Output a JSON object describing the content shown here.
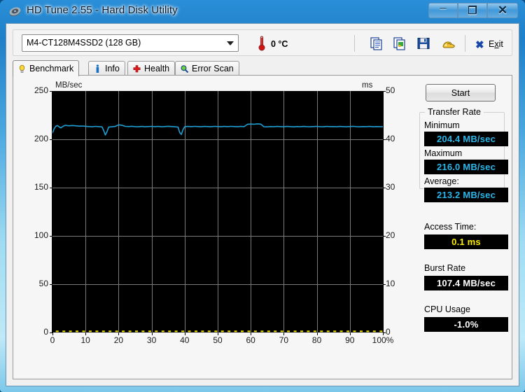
{
  "window": {
    "title": "HD Tune 2.55 - Hard Disk Utility",
    "icon": "hdd-icon",
    "minimize_label": "─",
    "maximize_label": "❐",
    "close_label": "✕"
  },
  "toolbar": {
    "drive": {
      "selected": "M4-CT128M4SSD2 (128 GB)",
      "options": [
        "M4-CT128M4SSD2 (128 GB)"
      ]
    },
    "temperature": "0 °C",
    "temp_icon": "thermometer-icon",
    "buttons": [
      {
        "name": "copy-text-icon",
        "label": ""
      },
      {
        "name": "copy-image-icon",
        "label": ""
      },
      {
        "name": "save-icon",
        "label": ""
      },
      {
        "name": "options-icon",
        "label": ""
      }
    ],
    "exit": {
      "label": "Exit",
      "accel": "x",
      "icon": "close-x-icon"
    }
  },
  "tabs": [
    {
      "label": "Benchmark",
      "icon": "lightbulb-icon",
      "active": true
    },
    {
      "label": "Info",
      "icon": "info-icon",
      "active": false
    },
    {
      "label": "Health",
      "icon": "health-cross-icon",
      "active": false
    },
    {
      "label": "Error Scan",
      "icon": "magnifier-icon",
      "active": false
    }
  ],
  "actions": {
    "start": "Start"
  },
  "results": {
    "transfer_rate": {
      "group_title": "Transfer Rate",
      "minimum_label": "Minimum",
      "minimum_value": "204.4 MB/sec",
      "maximum_label": "Maximum",
      "maximum_value": "216.0 MB/sec",
      "average_label": "Average:",
      "average_value": "213.2 MB/sec"
    },
    "access_time_label": "Access Time:",
    "access_time_value": "0.1 ms",
    "burst_rate_label": "Burst Rate",
    "burst_rate_value": "107.4 MB/sec",
    "cpu_usage_label": "CPU Usage",
    "cpu_usage_value": "-1.0%"
  },
  "colors": {
    "transfer_curve": "#1f9fd4",
    "access_dots": "#f2e300",
    "plot_background": "#000000",
    "grid": "#7a7a7a",
    "value_cyan": "#29b6e8",
    "value_yellow": "#ffee00",
    "value_white": "#ffffff"
  },
  "chart_data": {
    "type": "line",
    "title": "",
    "xlabel": "",
    "ylabel": "MB/sec",
    "y2label": "ms",
    "xlim": [
      0,
      100
    ],
    "ylim": [
      0,
      250
    ],
    "y2lim": [
      0,
      50
    ],
    "grid": true,
    "legend": "none",
    "xticks": [
      0,
      10,
      20,
      30,
      40,
      50,
      60,
      70,
      80,
      90,
      100
    ],
    "xticklabels": [
      "0",
      "10",
      "20",
      "30",
      "40",
      "50",
      "60",
      "70",
      "80",
      "90",
      "100%"
    ],
    "yticks": [
      0,
      50,
      100,
      150,
      200,
      250
    ],
    "yticklabels": [
      "0",
      "50",
      "100",
      "150",
      "200",
      "250"
    ],
    "y2ticks": [
      0,
      10,
      20,
      30,
      40,
      50
    ],
    "y2ticklabels": [
      "0",
      "10",
      "20",
      "30",
      "40",
      "50"
    ],
    "series": [
      {
        "name": "Transfer rate",
        "axis": "left",
        "color": "#1f9fd4",
        "x": [
          0,
          0.5,
          1,
          1.5,
          2,
          2.5,
          3,
          3.5,
          4,
          4.5,
          5,
          6,
          7,
          8,
          9,
          10,
          11,
          12,
          13,
          14,
          15,
          15.5,
          16,
          16.5,
          17,
          18,
          19,
          20,
          21,
          22,
          23,
          24,
          25,
          26,
          27,
          28,
          29,
          30,
          31,
          32,
          33,
          34,
          35,
          36,
          37,
          38,
          38.5,
          39,
          39.5,
          40,
          41,
          42,
          43,
          44,
          45,
          46,
          47,
          48,
          49,
          50,
          51,
          52,
          53,
          54,
          55,
          56,
          57,
          58,
          59,
          60,
          61,
          62,
          63,
          64,
          65,
          66,
          67,
          68,
          69,
          70,
          71,
          72,
          73,
          74,
          75,
          76,
          77,
          78,
          79,
          80,
          81,
          82,
          83,
          84,
          85,
          86,
          87,
          88,
          89,
          90,
          91,
          92,
          93,
          94,
          95,
          96,
          97,
          98,
          99,
          100
        ],
        "y": [
          206.5,
          211.0,
          213.5,
          214.2,
          213.0,
          211.8,
          213.0,
          214.0,
          214.5,
          214.2,
          214.0,
          214.3,
          214.0,
          213.6,
          213.8,
          213.5,
          213.2,
          213.0,
          213.4,
          213.1,
          212.8,
          209.0,
          204.4,
          208.0,
          212.6,
          213.0,
          213.3,
          215.0,
          214.6,
          213.4,
          213.2,
          213.5,
          213.1,
          213.0,
          213.3,
          213.0,
          213.2,
          213.4,
          213.1,
          213.3,
          213.0,
          213.2,
          213.5,
          213.2,
          213.0,
          212.6,
          207.0,
          205.0,
          210.0,
          213.0,
          213.3,
          213.1,
          213.4,
          213.2,
          213.0,
          213.3,
          213.2,
          213.0,
          213.4,
          213.2,
          213.0,
          213.3,
          213.1,
          213.4,
          213.2,
          213.0,
          213.3,
          213.1,
          215.5,
          215.8,
          215.6,
          216.0,
          215.7,
          213.0,
          212.9,
          213.2,
          213.0,
          213.3,
          213.1,
          213.0,
          213.3,
          213.1,
          212.9,
          213.2,
          213.0,
          213.3,
          213.1,
          213.0,
          213.2,
          213.4,
          213.1,
          213.0,
          213.3,
          213.1,
          213.2,
          213.0,
          213.3,
          213.1,
          213.0,
          213.2,
          213.4,
          213.1,
          213.0,
          213.2,
          213.1,
          213.3,
          213.0,
          213.2,
          213.1,
          213.0,
          212.8
        ]
      },
      {
        "name": "Access time",
        "axis": "right",
        "color": "#f2e300",
        "style": "dots",
        "x": [
          1,
          3,
          5,
          7,
          9,
          11,
          13,
          15,
          17,
          19,
          21,
          23,
          25,
          27,
          29,
          31,
          33,
          35,
          37,
          39,
          41,
          43,
          45,
          47,
          49,
          51,
          53,
          55,
          57,
          59,
          61,
          63,
          65,
          67,
          69,
          71,
          73,
          75,
          77,
          79,
          81,
          83,
          85,
          87,
          89,
          91,
          93,
          95,
          97,
          99
        ],
        "y": [
          0.1,
          0.1,
          0.1,
          0.1,
          0.1,
          0.1,
          0.1,
          0.1,
          0.1,
          0.1,
          0.1,
          0.1,
          0.1,
          0.1,
          0.1,
          0.1,
          0.1,
          0.1,
          0.1,
          0.1,
          0.1,
          0.1,
          0.1,
          0.1,
          0.1,
          0.1,
          0.1,
          0.1,
          0.1,
          0.1,
          0.1,
          0.1,
          0.1,
          0.1,
          0.1,
          0.1,
          0.1,
          0.1,
          0.1,
          0.1,
          0.1,
          0.1,
          0.1,
          0.1,
          0.1,
          0.1,
          0.1,
          0.1,
          0.1,
          0.1
        ]
      }
    ]
  }
}
